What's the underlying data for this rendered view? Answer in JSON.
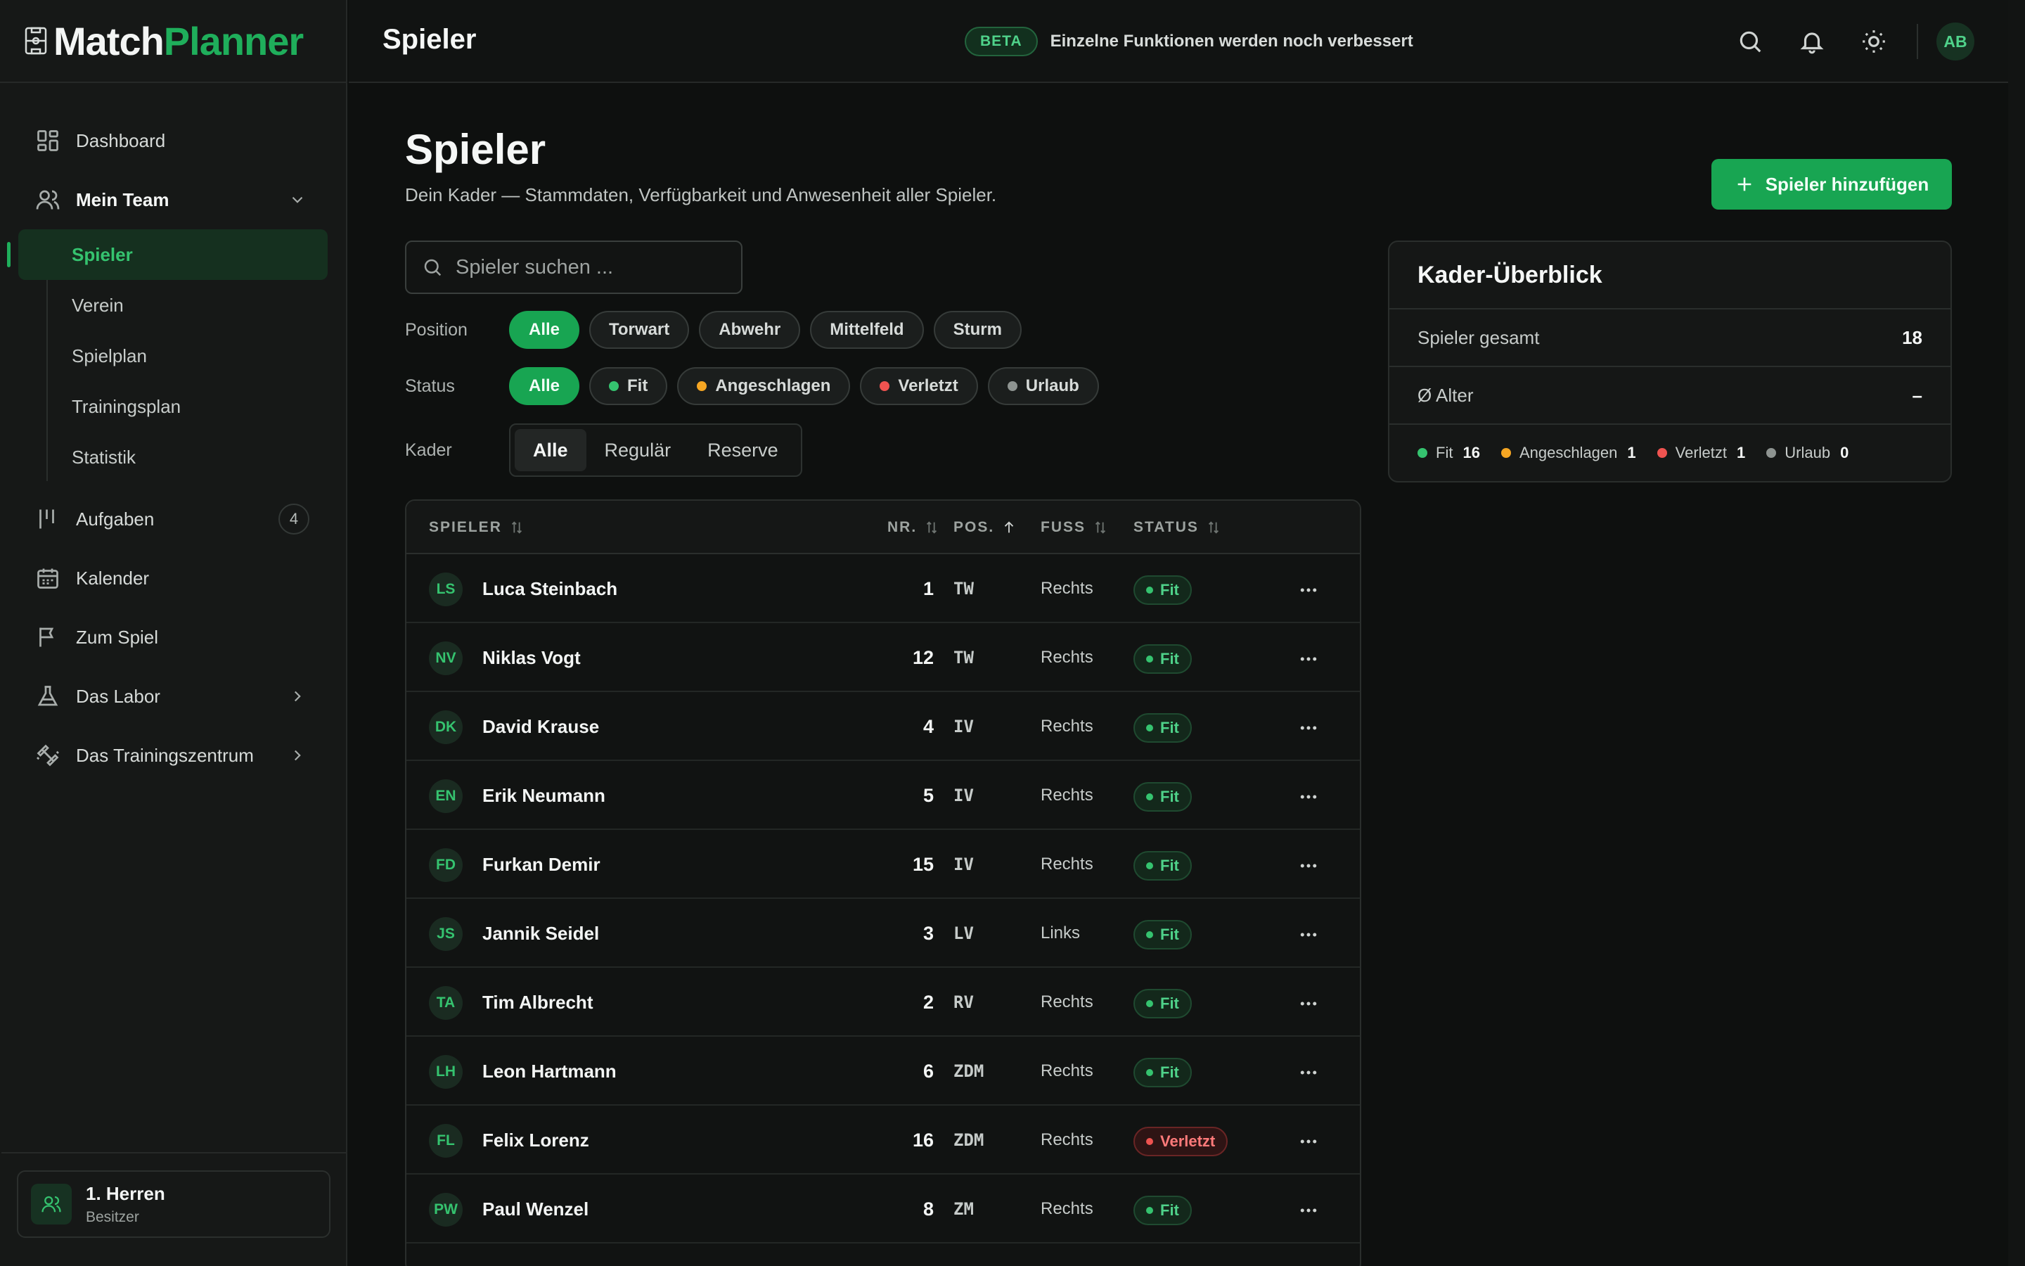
{
  "app": {
    "name_part1": "Match",
    "name_part2": "Planner"
  },
  "colors": {
    "accent": "#18a552",
    "fit": "#35c36f",
    "knock": "#f5a623",
    "injured": "#ef5350",
    "vacation": "#8e9491"
  },
  "sidebar": {
    "items": [
      {
        "label": "Dashboard",
        "icon": "dashboard-icon"
      },
      {
        "label": "Mein Team",
        "icon": "users-icon"
      },
      {
        "label": "Aufgaben",
        "icon": "tasks-icon",
        "count": "4"
      },
      {
        "label": "Kalender",
        "icon": "calendar-icon"
      },
      {
        "label": "Zum Spiel",
        "icon": "flag-icon"
      },
      {
        "label": "Das Labor",
        "icon": "flask-icon"
      },
      {
        "label": "Das Trainingszentrum",
        "icon": "dumbbell-icon"
      }
    ],
    "team_sub": [
      "Spieler",
      "Verein",
      "Spielplan",
      "Trainingsplan",
      "Statistik"
    ],
    "team_box": {
      "name": "1. Herren",
      "role": "Besitzer"
    }
  },
  "topbar": {
    "title": "Spieler",
    "beta_badge": "BETA",
    "beta_text": "Einzelne Funktionen werden noch verbessert",
    "avatar": "AB"
  },
  "page": {
    "title": "Spieler",
    "subtitle": "Dein Kader — Stammdaten, Verfügbarkeit und Anwesenheit aller Spieler.",
    "add_button": "Spieler hinzufügen",
    "search_placeholder": "Spieler suchen ..."
  },
  "filters": {
    "position_label": "Position",
    "positions": [
      "Alle",
      "Torwart",
      "Abwehr",
      "Mittelfeld",
      "Sturm"
    ],
    "status_label": "Status",
    "statuses": [
      "Alle",
      "Fit",
      "Angeschlagen",
      "Verletzt",
      "Urlaub"
    ],
    "kader_label": "Kader",
    "kader": [
      "Alle",
      "Regulär",
      "Reserve"
    ]
  },
  "table": {
    "headers": {
      "player": "SPIELER",
      "nr": "NR.",
      "pos": "POS.",
      "foot": "FUSS",
      "status": "STATUS"
    },
    "rows": [
      {
        "initials": "LS",
        "name": "Luca Steinbach",
        "nr": "1",
        "pos": "TW",
        "foot": "Rechts",
        "status": "Fit"
      },
      {
        "initials": "NV",
        "name": "Niklas Vogt",
        "nr": "12",
        "pos": "TW",
        "foot": "Rechts",
        "status": "Fit"
      },
      {
        "initials": "DK",
        "name": "David Krause",
        "nr": "4",
        "pos": "IV",
        "foot": "Rechts",
        "status": "Fit"
      },
      {
        "initials": "EN",
        "name": "Erik Neumann",
        "nr": "5",
        "pos": "IV",
        "foot": "Rechts",
        "status": "Fit"
      },
      {
        "initials": "FD",
        "name": "Furkan Demir",
        "nr": "15",
        "pos": "IV",
        "foot": "Rechts",
        "status": "Fit"
      },
      {
        "initials": "JS",
        "name": "Jannik Seidel",
        "nr": "3",
        "pos": "LV",
        "foot": "Links",
        "status": "Fit"
      },
      {
        "initials": "TA",
        "name": "Tim Albrecht",
        "nr": "2",
        "pos": "RV",
        "foot": "Rechts",
        "status": "Fit"
      },
      {
        "initials": "LH",
        "name": "Leon Hartmann",
        "nr": "6",
        "pos": "ZDM",
        "foot": "Rechts",
        "status": "Fit"
      },
      {
        "initials": "FL",
        "name": "Felix Lorenz",
        "nr": "16",
        "pos": "ZDM",
        "foot": "Rechts",
        "status": "Verletzt"
      },
      {
        "initials": "PW",
        "name": "Paul Wenzel",
        "nr": "8",
        "pos": "ZM",
        "foot": "Rechts",
        "status": "Fit"
      }
    ]
  },
  "overview": {
    "title": "Kader-Überblick",
    "total_label": "Spieler gesamt",
    "total_value": "18",
    "age_label": "Ø Alter",
    "age_value": "–",
    "legend": [
      {
        "label": "Fit",
        "value": "16"
      },
      {
        "label": "Angeschlagen",
        "value": "1"
      },
      {
        "label": "Verletzt",
        "value": "1"
      },
      {
        "label": "Urlaub",
        "value": "0"
      }
    ]
  }
}
